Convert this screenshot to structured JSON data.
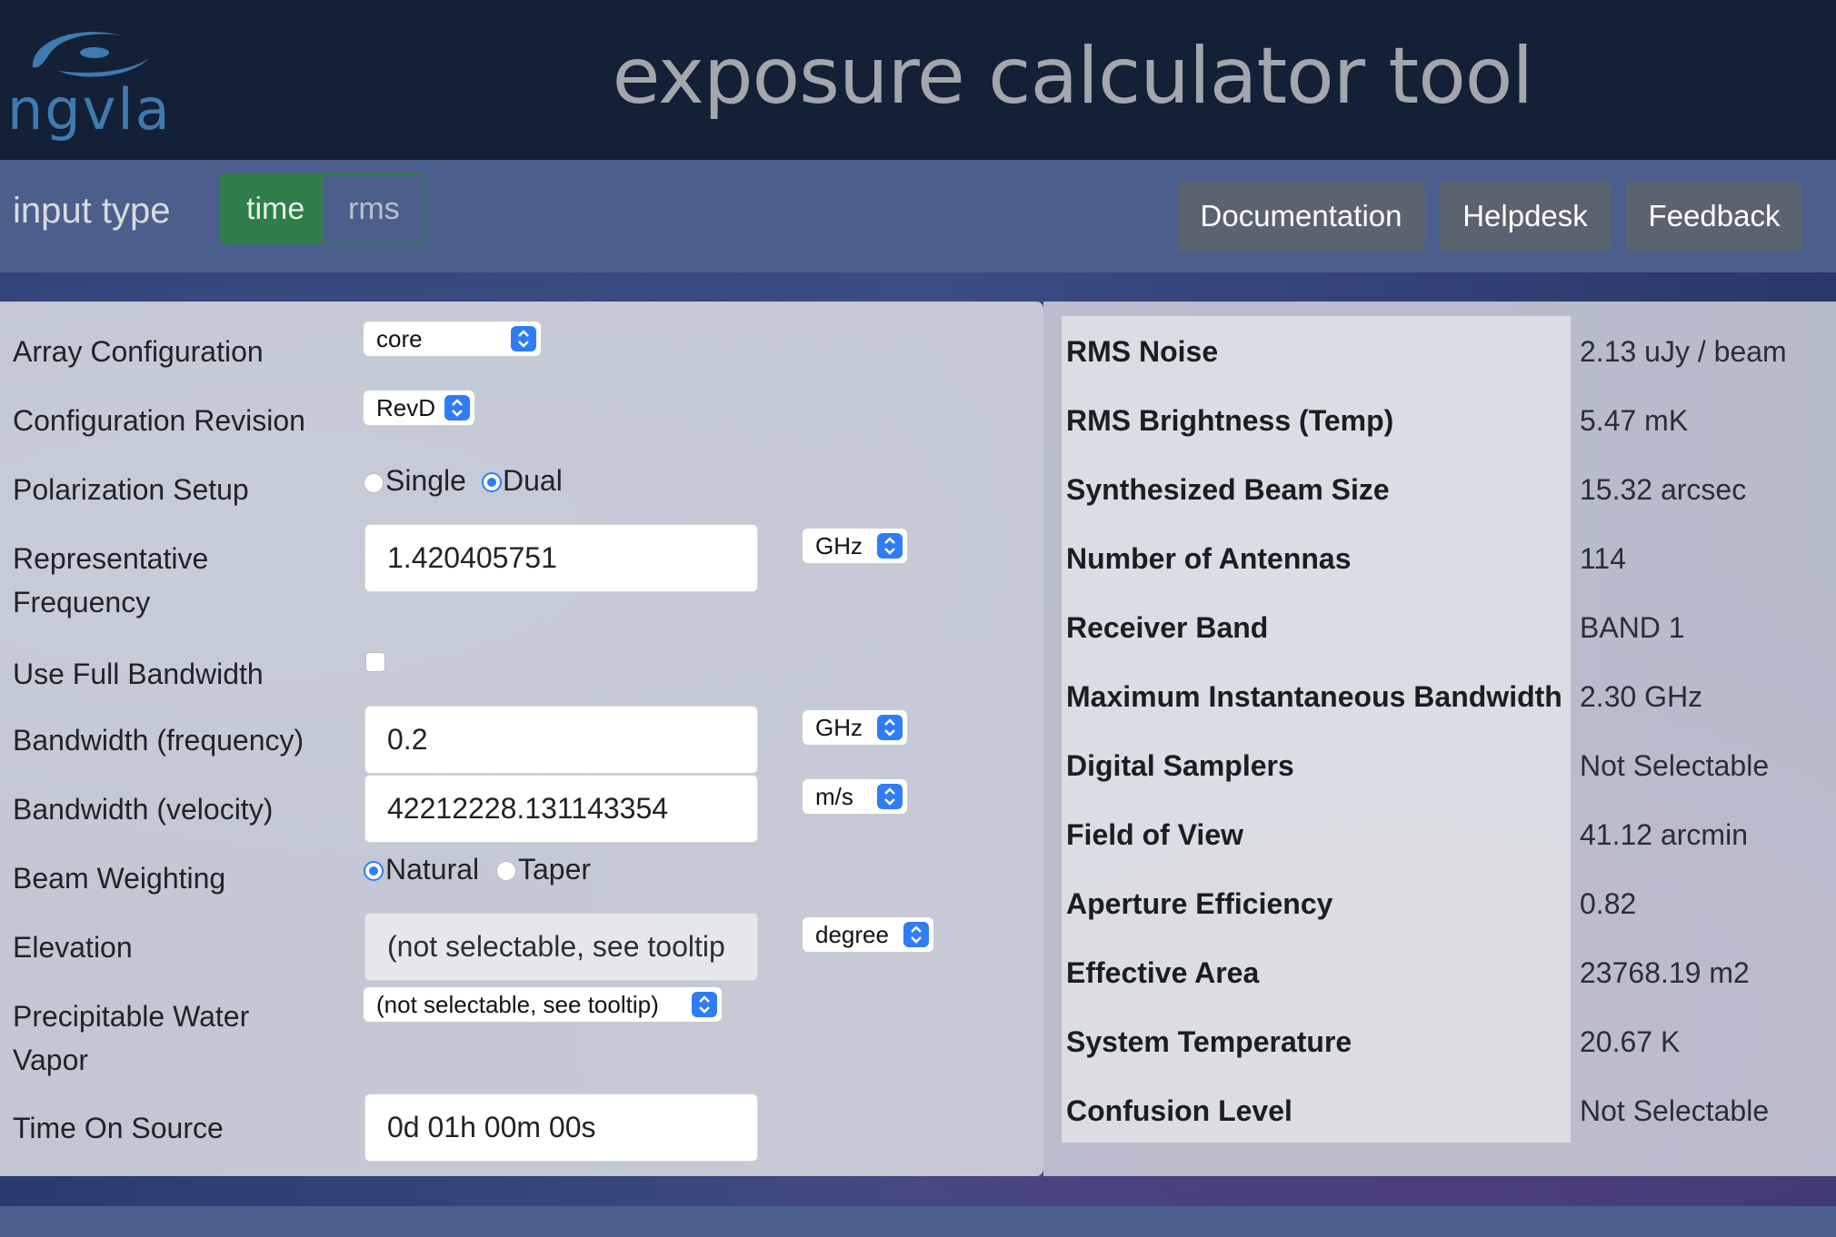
{
  "header": {
    "logo_text": "ngvla",
    "title": "exposure calculator tool"
  },
  "toolbar": {
    "input_type_label": "input type",
    "options": [
      "time",
      "rms"
    ],
    "selected": "time",
    "buttons": [
      "Documentation",
      "Helpdesk",
      "Feedback"
    ]
  },
  "form": {
    "array_configuration": {
      "label": "Array Configuration",
      "value": "core"
    },
    "configuration_revision": {
      "label": "Configuration Revision",
      "value": "RevD"
    },
    "polarization_setup": {
      "label": "Polarization Setup",
      "options": [
        "Single",
        "Dual"
      ],
      "selected": "Dual"
    },
    "representative_frequency": {
      "label_line1": "Representative",
      "label_line2": "Frequency",
      "value": "1.420405751",
      "unit": "GHz"
    },
    "use_full_bandwidth": {
      "label": "Use Full Bandwidth",
      "checked": false
    },
    "bandwidth_frequency": {
      "label": "Bandwidth (frequency)",
      "value": "0.2",
      "unit": "GHz"
    },
    "bandwidth_velocity": {
      "label": "Bandwidth (velocity)",
      "value": "42212228.131143354",
      "unit": "m/s"
    },
    "beam_weighting": {
      "label": "Beam Weighting",
      "options": [
        "Natural",
        "Taper"
      ],
      "selected": "Natural"
    },
    "elevation": {
      "label": "Elevation",
      "value": "(not selectable, see tooltip",
      "unit": "degree"
    },
    "pwv": {
      "label_line1": "Precipitable Water",
      "label_line2": "Vapor",
      "value": "(not selectable, see tooltip)"
    },
    "time_on_source": {
      "label": "Time On Source",
      "value": "0d 01h 00m 00s"
    }
  },
  "results": [
    {
      "key": "RMS Noise",
      "value": "2.13 uJy / beam"
    },
    {
      "key": "RMS Brightness (Temp)",
      "value": "5.47 mK"
    },
    {
      "key": "Synthesized Beam Size",
      "value": "15.32 arcsec"
    },
    {
      "key": "Number of Antennas",
      "value": "114"
    },
    {
      "key": "Receiver Band",
      "value": "BAND 1"
    },
    {
      "key": "Maximum Instantaneous Bandwidth",
      "value": "2.30 GHz"
    },
    {
      "key": "Digital Samplers",
      "value": "Not Selectable"
    },
    {
      "key": "Field of View",
      "value": "41.12 arcmin"
    },
    {
      "key": "Aperture Efficiency",
      "value": "0.82"
    },
    {
      "key": "Effective Area",
      "value": "23768.19 m2"
    },
    {
      "key": "System Temperature",
      "value": "20.67 K"
    },
    {
      "key": "Confusion Level",
      "value": "Not Selectable"
    }
  ]
}
